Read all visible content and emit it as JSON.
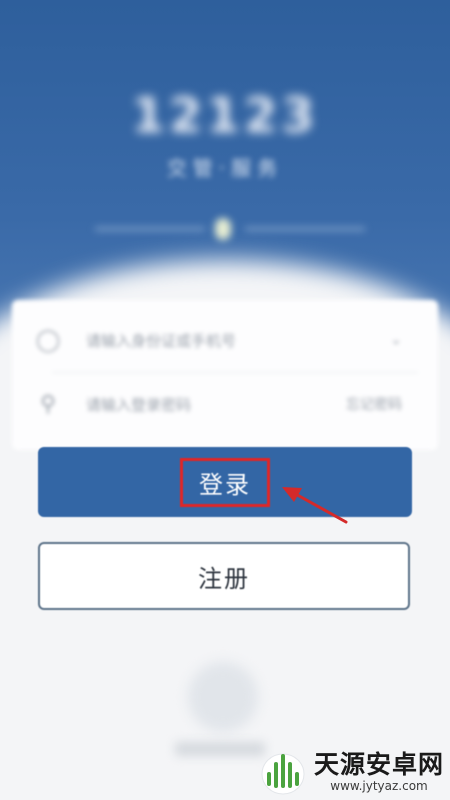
{
  "header": {
    "title": "12123",
    "subtitle": "交管·服务"
  },
  "form": {
    "account_icon": "person-icon",
    "account_placeholder": "请输入身份证或手机号",
    "password_icon": "key-icon",
    "password_placeholder": "请输入登录密码",
    "forgot_label": "忘记密码"
  },
  "actions": {
    "login_label": "登录",
    "register_label": "注册"
  },
  "annotation": {
    "highlight_color": "#e12626",
    "arrow_color": "#d42a2a"
  },
  "watermark": {
    "logo_icon": "android-logo-icon",
    "name": "天源安卓网",
    "url": "www.jytyaz.com"
  },
  "colors": {
    "primary": "#3366a5",
    "header_bg": "#2e5f9c"
  }
}
